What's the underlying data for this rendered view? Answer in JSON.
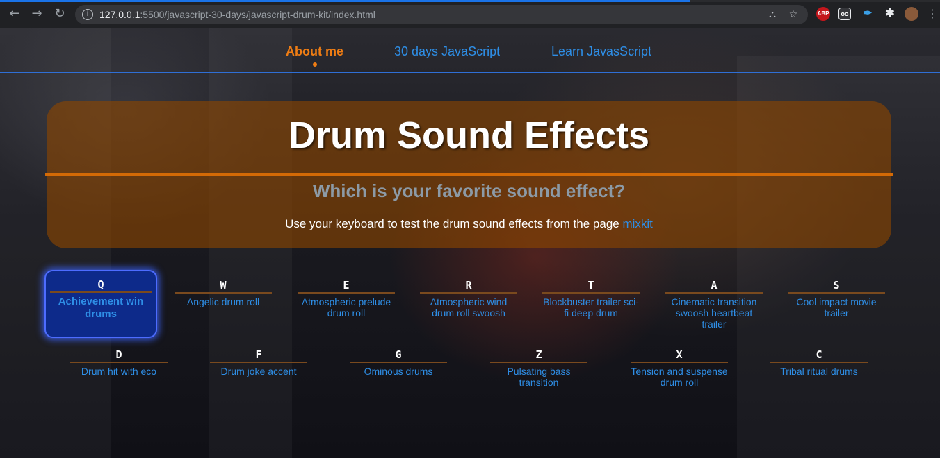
{
  "browser": {
    "url_host": "127.0.0.1",
    "url_rest": ":5500/javascript-30-days/javascript-drum-kit/index.html",
    "ext_abp": "ABP"
  },
  "nav": {
    "items": [
      "About me",
      "30 days JavaScript",
      "Learn JavasScript"
    ],
    "active": "About me"
  },
  "hero": {
    "title": "Drum Sound Effects",
    "subtitle": "Which is your favorite sound effect?",
    "text": "Use your keyboard to test the drum sound effects from the page ",
    "link": "mixkit"
  },
  "keys": [
    {
      "key": "Q",
      "label": "Achievement win drums",
      "playing": true
    },
    {
      "key": "W",
      "label": "Angelic drum roll"
    },
    {
      "key": "E",
      "label": "Atmospheric prelude drum roll"
    },
    {
      "key": "R",
      "label": "Atmospheric wind drum roll swoosh"
    },
    {
      "key": "T",
      "label": "Blockbuster trailer sci-fi deep drum"
    },
    {
      "key": "A",
      "label": "Cinematic transition swoosh heartbeat trailer"
    },
    {
      "key": "S",
      "label": "Cool impact movie trailer"
    },
    {
      "key": "D",
      "label": "Drum hit with eco"
    },
    {
      "key": "F",
      "label": "Drum joke accent"
    },
    {
      "key": "G",
      "label": "Ominous drums"
    },
    {
      "key": "Z",
      "label": "Pulsating bass transition"
    },
    {
      "key": "X",
      "label": "Tension and suspense drum roll"
    },
    {
      "key": "C",
      "label": "Tribal ritual drums"
    }
  ],
  "colors": {
    "accent_orange": "#ef7d14",
    "link_blue": "#2e8ee6",
    "playing_border": "#4d6cff"
  }
}
